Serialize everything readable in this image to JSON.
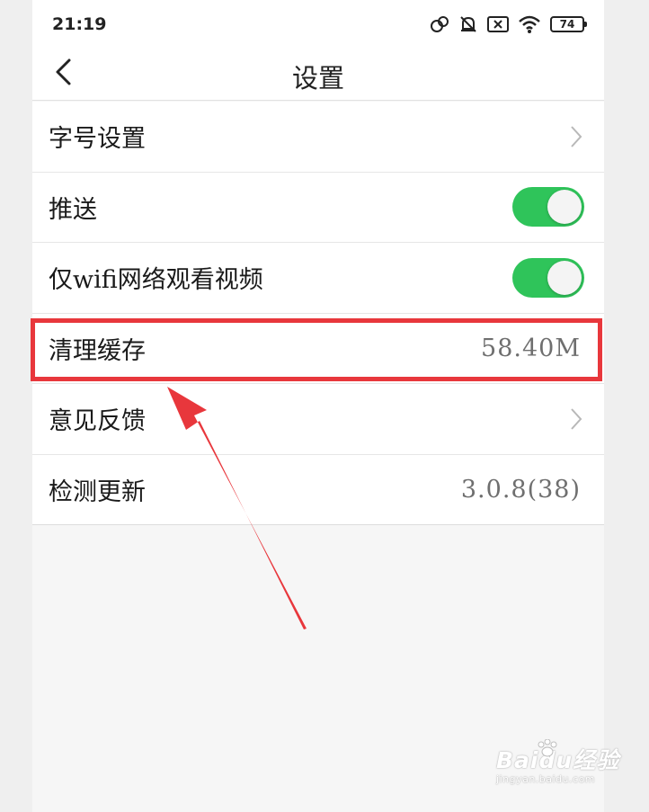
{
  "status_bar": {
    "time": "21:19",
    "battery_level": "74",
    "icons": [
      "link-icon",
      "bell-off-icon",
      "sim-blocked-icon",
      "wifi-icon",
      "battery-icon"
    ]
  },
  "nav": {
    "title": "设置",
    "back_icon": "chevron-left-icon"
  },
  "settings": {
    "font_size": {
      "label": "字号设置",
      "icon": "chevron-right-icon"
    },
    "push": {
      "label": "推送",
      "enabled": true
    },
    "wifi_only": {
      "label": "仅wifi网络观看视频",
      "enabled": true
    },
    "clear_cache": {
      "label": "清理缓存",
      "value": "58.40M"
    },
    "feedback": {
      "label": "意见反馈",
      "icon": "chevron-right-icon"
    },
    "check_update": {
      "label": "检测更新",
      "value": "3.0.8(38)"
    }
  },
  "annotation": {
    "highlight_color": "#e8373c",
    "toggle_on_color": "#2fc45a"
  },
  "watermark": {
    "brand": "Baidu",
    "suffix": "经验",
    "url": "jingyan.baidu.com"
  }
}
